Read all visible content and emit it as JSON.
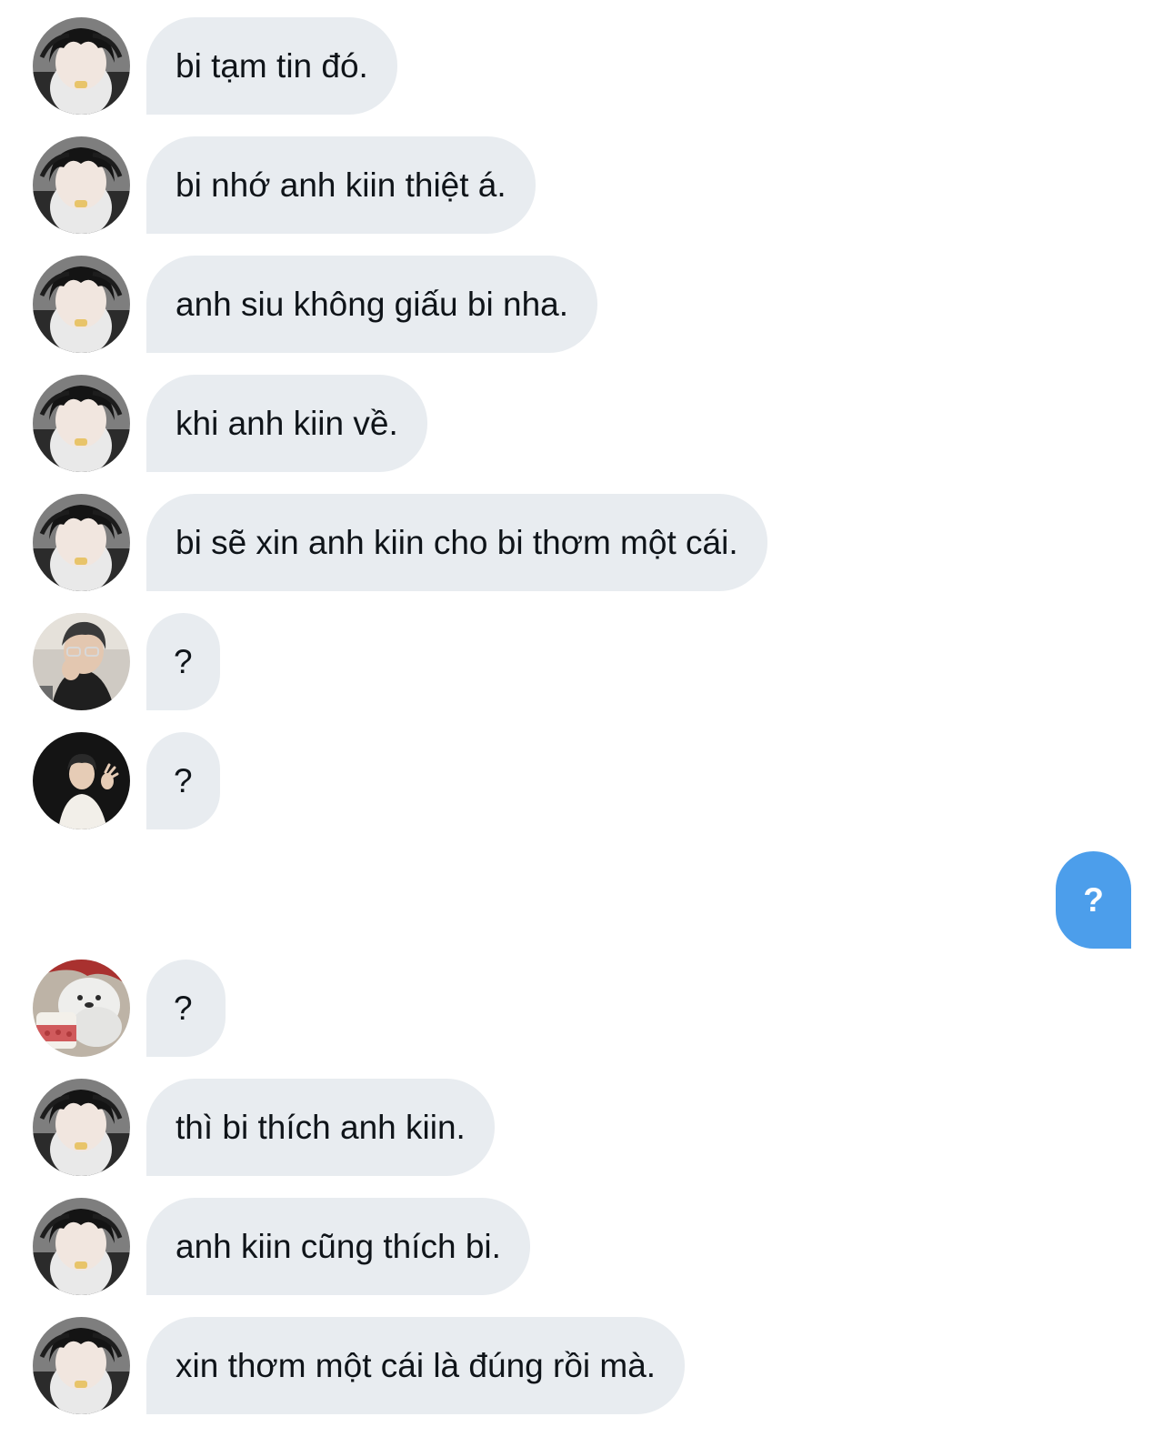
{
  "conversation": {
    "messages": [
      {
        "text": "bi tạm tin đó.",
        "avatar": "avatar-bi"
      },
      {
        "text": "bi nhớ anh kiin thiệt á.",
        "avatar": "avatar-bi"
      },
      {
        "text": "anh siu không giấu bi nha.",
        "avatar": "avatar-bi"
      },
      {
        "text": "khi anh kiin về.",
        "avatar": "avatar-bi"
      },
      {
        "text": "bi sẽ xin anh kiin cho bi thơm một cái.",
        "avatar": "avatar-bi"
      },
      {
        "text": "?",
        "avatar": "avatar-glasses"
      },
      {
        "text": "?",
        "avatar": "avatar-dark-circle"
      },
      {
        "text": "?",
        "avatar": "avatar-bear"
      },
      {
        "text": "thì bi thích anh kiin.",
        "avatar": "avatar-bi"
      },
      {
        "text": "anh kiin cũng thích bi.",
        "avatar": "avatar-bi"
      },
      {
        "text": "xin thơm một cái là đúng rồi mà.",
        "avatar": "avatar-bi"
      }
    ],
    "own_message": {
      "text": "?"
    }
  },
  "colors": {
    "incoming_bubble": "#e8ecf0",
    "outgoing_bubble": "#4c9eeb",
    "text": "#0f1419"
  }
}
